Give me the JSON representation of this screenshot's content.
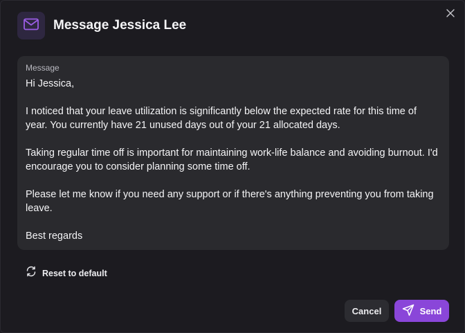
{
  "dialog": {
    "title": "Message Jessica Lee",
    "header_icon": "mail-icon",
    "close_icon": "close-icon"
  },
  "message": {
    "label": "Message",
    "body": "Hi Jessica,\n\nI noticed that your leave utilization is significantly below the expected rate for this time of year. You currently have 21 unused days out of your 21 allocated days.\n\nTaking regular time off is important for maintaining work-life balance and avoiding burnout. I'd encourage you to consider planning some time off.\n\nPlease let me know if you need any support or if there's anything preventing you from taking leave.\n\nBest regards"
  },
  "reset": {
    "label": "Reset to default",
    "icon": "refresh-icon"
  },
  "actions": {
    "cancel_label": "Cancel",
    "send_label": "Send",
    "send_icon": "send-icon"
  },
  "colors": {
    "background": "#1c1b20",
    "card": "#2a2a2e",
    "accent": "#8a46d9",
    "icon_box": "#2e2740",
    "icon_accent": "#9b5de5"
  }
}
